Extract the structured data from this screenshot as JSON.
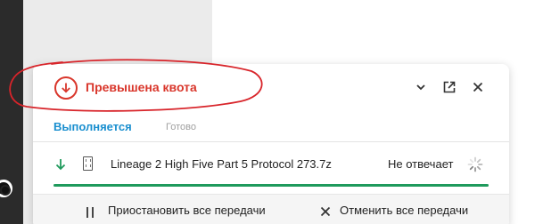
{
  "panel": {
    "title": "Превышена квота",
    "title_color": "#d9362b",
    "icons": {
      "status": "download-error-icon",
      "collapse": "chevron-down-icon",
      "popout": "popout-icon",
      "close": "close-icon"
    }
  },
  "tabs": {
    "active": "Выполняется",
    "done": "Готово",
    "accent": "#1a8fcf"
  },
  "transfer": {
    "name": "Lineage 2 High Five Part 5 Protocol 273.7z",
    "status": "Не отвечает",
    "progress_percent": 100,
    "progress_color": "#1f9a5c"
  },
  "footer": {
    "pause_all": "Приостановить все передачи",
    "cancel_all": "Отменить все передачи"
  }
}
